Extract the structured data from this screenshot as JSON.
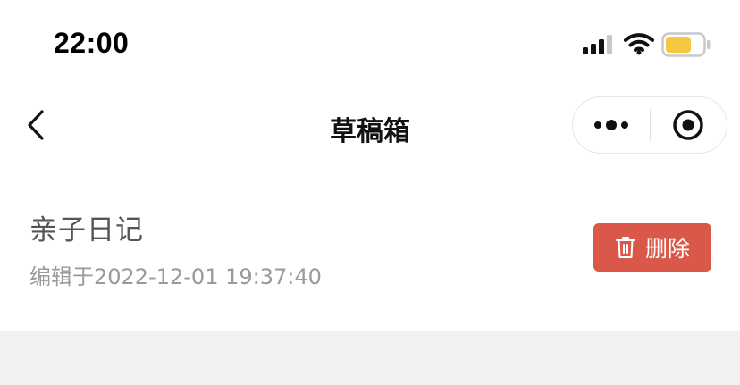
{
  "status_bar": {
    "time": "22:00",
    "battery_color": "#f5c842"
  },
  "nav": {
    "title": "草稿箱",
    "back_icon": "chevron-left-icon",
    "more_icon": "more-dots-icon",
    "close_icon": "target-circle-icon"
  },
  "drafts": [
    {
      "title": "亲子日记",
      "edited": "编辑于2022-12-01 19:37:40",
      "delete_label": "删除"
    }
  ],
  "colors": {
    "delete": "#d9584a",
    "background_gray": "#f2f1ef"
  }
}
